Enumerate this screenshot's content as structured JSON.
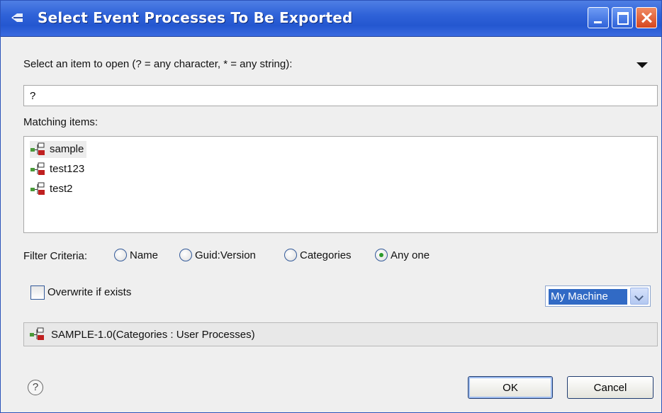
{
  "window": {
    "title": "Select Event Processes To Be Exported"
  },
  "prompt": "Select an item to open (? = any character, * = any string):",
  "filter": {
    "value": "?"
  },
  "matching_label": "Matching items:",
  "items": [
    {
      "label": "sample",
      "selected": true
    },
    {
      "label": "test123",
      "selected": false
    },
    {
      "label": "test2",
      "selected": false
    }
  ],
  "filter_criteria": {
    "label": "Filter Criteria:",
    "options": [
      {
        "label": "Name",
        "checked": false
      },
      {
        "label": "Guid:Version",
        "checked": false
      },
      {
        "label": "Categories",
        "checked": false
      },
      {
        "label": "Any one",
        "checked": true
      }
    ]
  },
  "overwrite": {
    "label": "Overwrite if exists",
    "checked": false
  },
  "target": {
    "selected": "My Machine"
  },
  "status": "SAMPLE-1.0(Categories : User Processes)",
  "buttons": {
    "ok": "OK",
    "cancel": "Cancel",
    "help": "?"
  },
  "colors": {
    "titlebar": "#2457d0",
    "selection": "#316ac5",
    "radio_dot": "#2a9a2a"
  },
  "icons": {
    "app": "eclipse-icon",
    "process": "process-tree-icon",
    "help": "help-icon"
  }
}
